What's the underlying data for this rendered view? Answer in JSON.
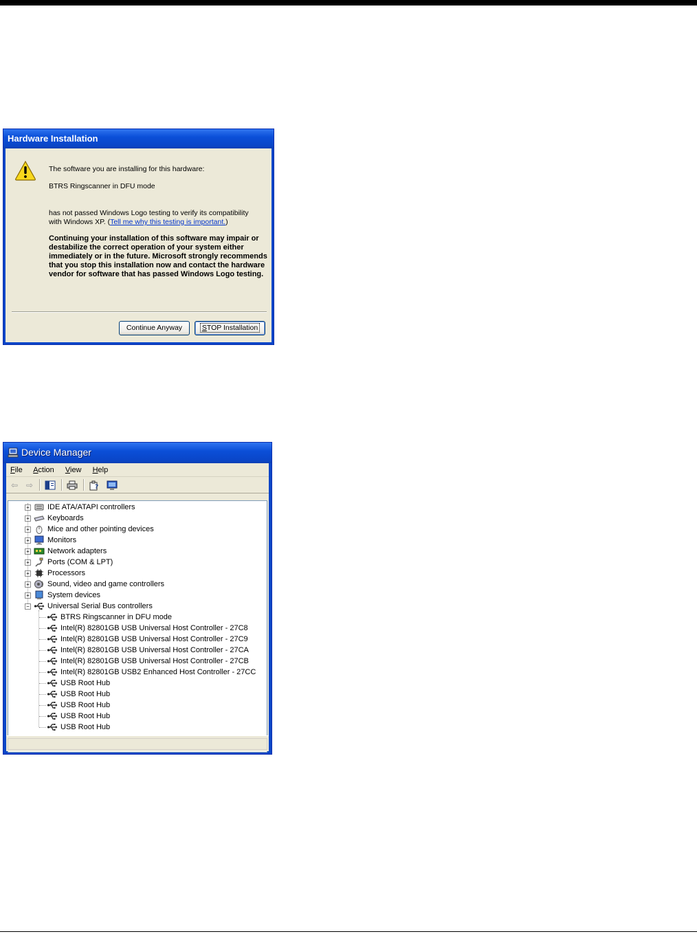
{
  "hardware_dialog": {
    "title": "Hardware Installation",
    "line1": "The software you are installing for this hardware:",
    "device_name": "BTRS Ringscanner in DFU mode",
    "logo_text": "has not passed Windows Logo testing to verify its compatibility with Windows XP. (",
    "logo_link": "Tell me why this testing is important.",
    "logo_close": ")",
    "warning": "Continuing your installation of this software may impair or destabilize the correct operation of your system either immediately or in the future. Microsoft strongly recommends that you stop this installation now and contact the hardware vendor for software that has passed Windows Logo testing.",
    "continue_button": "Continue Anyway",
    "stop_button": "STOP Installation"
  },
  "device_manager": {
    "title": "Device Manager",
    "menu": [
      "File",
      "Action",
      "View",
      "Help"
    ],
    "tree": {
      "categories": [
        {
          "label": "IDE ATA/ATAPI controllers",
          "icon": "ide-controller-icon"
        },
        {
          "label": "Keyboards",
          "icon": "keyboard-icon"
        },
        {
          "label": "Mice and other pointing devices",
          "icon": "mouse-icon"
        },
        {
          "label": "Monitors",
          "icon": "monitor-icon"
        },
        {
          "label": "Network adapters",
          "icon": "network-adapter-icon"
        },
        {
          "label": "Ports (COM & LPT)",
          "icon": "port-icon"
        },
        {
          "label": "Processors",
          "icon": "processor-icon"
        },
        {
          "label": "Sound, video and game controllers",
          "icon": "sound-icon"
        },
        {
          "label": "System devices",
          "icon": "system-device-icon"
        },
        {
          "label": "Universal Serial Bus controllers",
          "icon": "usb-icon"
        }
      ],
      "usb_children": [
        "BTRS Ringscanner in DFU mode",
        "Intel(R) 82801GB USB Universal Host Controller - 27C8",
        "Intel(R) 82801GB USB Universal Host Controller - 27C9",
        "Intel(R) 82801GB USB Universal Host Controller - 27CA",
        "Intel(R) 82801GB USB Universal Host Controller - 27CB",
        "Intel(R) 82801GB USB2 Enhanced Host Controller - 27CC",
        "USB Root Hub",
        "USB Root Hub",
        "USB Root Hub",
        "USB Root Hub",
        "USB Root Hub"
      ]
    }
  }
}
